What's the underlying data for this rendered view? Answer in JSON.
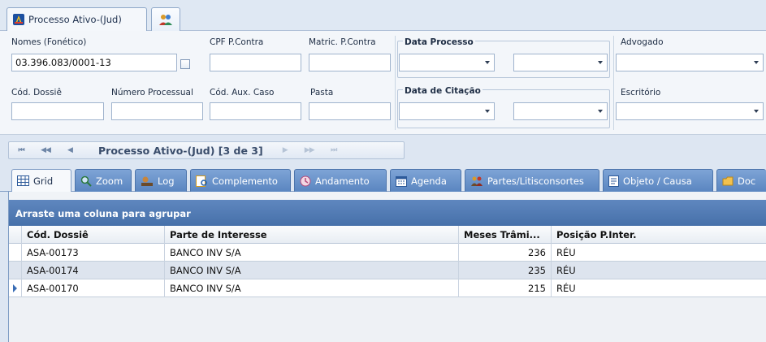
{
  "doc_tabs": [
    {
      "label": "Processo Ativo-(Jud)",
      "icon": "law-scale-icon"
    },
    {
      "label": "",
      "icon": "users-group-icon"
    }
  ],
  "filters": {
    "nomes_label": "Nomes (Fonético)",
    "nomes_value": "03.396.083/0001-13",
    "cpf_label": "CPF P.Contra",
    "matric_label": "Matric. P.Contra",
    "data_processo_label": "Data Processo",
    "advogado_label": "Advogado",
    "cod_dossie_label": "Cód. Dossiê",
    "numero_processual_label": "Número Processual",
    "cod_aux_label": "Cód. Aux. Caso",
    "pasta_label": "Pasta",
    "data_citacao_label": "Data de Citação",
    "escritorio_label": "Escritório"
  },
  "navigator": {
    "first": "⏮",
    "prev_page": "◀◀",
    "prev": "◀",
    "title": "Processo Ativo-(Jud) [3 de 3]",
    "next": "▶",
    "next_page": "▶▶",
    "last": "⏭"
  },
  "view_tabs": [
    {
      "label": "Grid",
      "icon": "grid-icon"
    },
    {
      "label": "Zoom",
      "icon": "zoom-icon"
    },
    {
      "label": "Log",
      "icon": "log-icon"
    },
    {
      "label": "Complemento",
      "icon": "complement-icon"
    },
    {
      "label": "Andamento",
      "icon": "progress-icon"
    },
    {
      "label": "Agenda",
      "icon": "calendar-icon"
    },
    {
      "label": "Partes/Litisconsortes",
      "icon": "people-icon"
    },
    {
      "label": "Objeto / Causa",
      "icon": "document-icon"
    },
    {
      "label": "Doc",
      "icon": "folder-icon"
    }
  ],
  "grid": {
    "group_hint": "Arraste uma coluna para agrupar",
    "columns": [
      "Cód. Dossiê",
      "Parte de Interesse",
      "Meses Trâmi...",
      "Posição P.Inter."
    ],
    "rows": [
      [
        "ASA-00173",
        "BANCO INV S/A",
        "236",
        "RÉU"
      ],
      [
        "ASA-00174",
        "BANCO INV S/A",
        "235",
        "RÉU"
      ],
      [
        "ASA-00170",
        "BANCO INV S/A",
        "215",
        "RÉU"
      ]
    ],
    "current_row_index": 2
  },
  "colors": {
    "accent": "#4670a9",
    "tab_blue": "#5a85c0",
    "panel_bg": "#f3f6fa"
  }
}
